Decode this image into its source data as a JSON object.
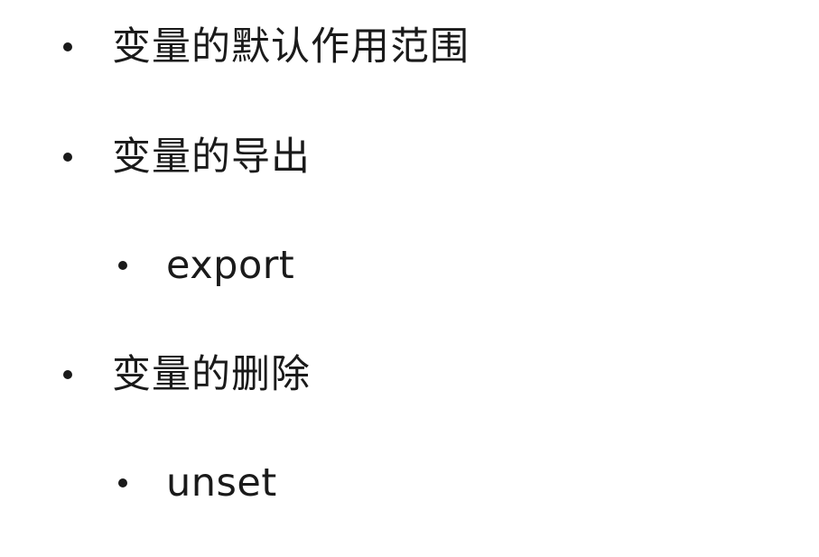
{
  "outline": {
    "items": [
      {
        "label": "变量的默认作用范围",
        "level": 1
      },
      {
        "label": "变量的导出",
        "level": 1
      },
      {
        "label": "export",
        "level": 2
      },
      {
        "label": "变量的删除",
        "level": 1
      },
      {
        "label": "unset",
        "level": 2
      }
    ]
  },
  "colors": {
    "background": "#ffffff",
    "text": "#1a1a1a"
  },
  "icons": {
    "bullet": "bullet-dot-icon"
  }
}
